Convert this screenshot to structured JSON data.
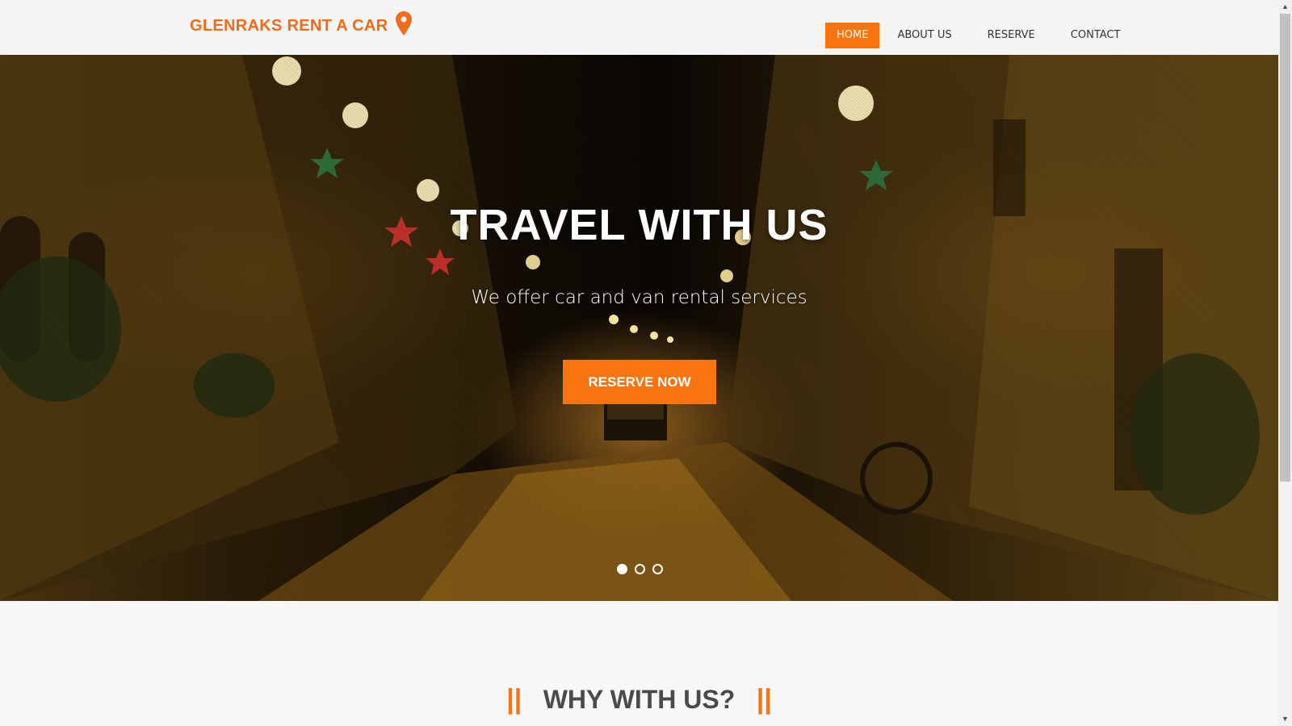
{
  "header": {
    "logo_text": "GLENRAKS RENT A CAR",
    "logo_icon": "map-pin-icon",
    "nav": [
      {
        "label": "HOME",
        "active": true
      },
      {
        "label": "ABOUT US",
        "active": false
      },
      {
        "label": "RESERVE",
        "active": false
      },
      {
        "label": "CONTACT",
        "active": false
      }
    ]
  },
  "hero": {
    "title": "TRAVEL WITH US",
    "subtitle": "We offer car and van rental services",
    "button_label": "RESERVE NOW",
    "slides": {
      "count": 3,
      "active_index": 0
    }
  },
  "section": {
    "left_ornament": "||",
    "title": "WHY WITH US?",
    "right_ornament": "||"
  },
  "colors": {
    "accent": "#f7740e",
    "logo": "#ef6c1a"
  }
}
